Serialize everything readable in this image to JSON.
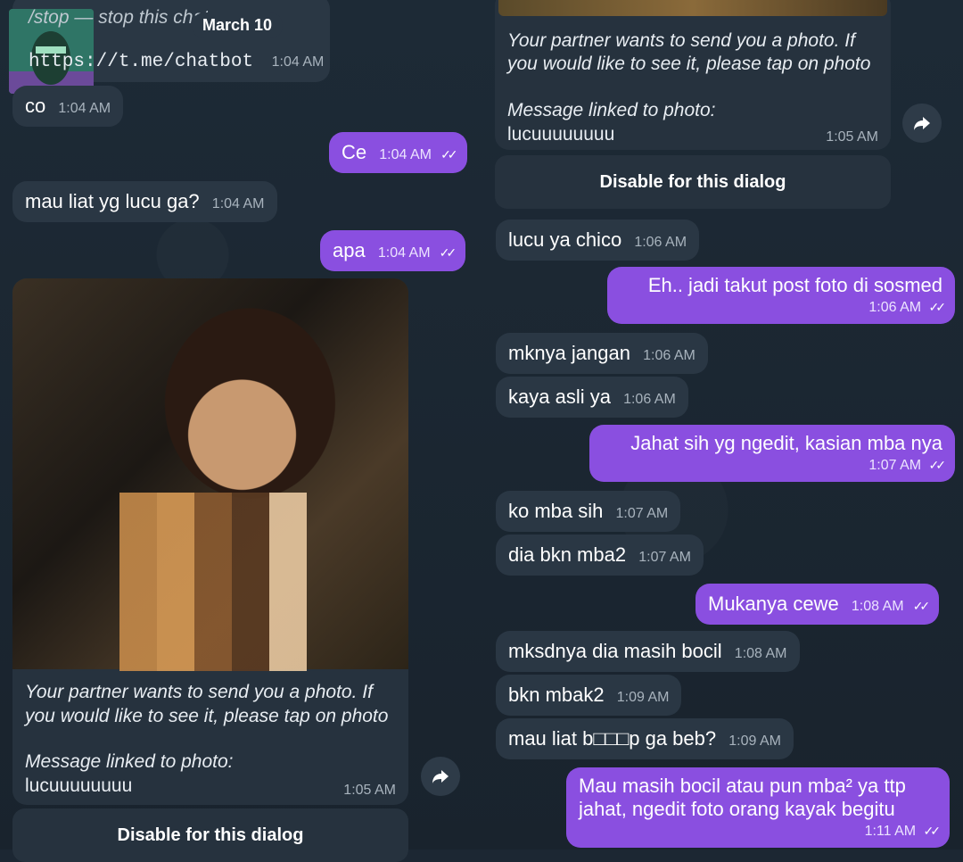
{
  "date_label": "March 10",
  "left": {
    "top_bubble": {
      "stop_text": "/stop — stop this chat",
      "link": "https://t.me/chatbot",
      "time": "1:04 AM"
    },
    "messages": [
      {
        "id": "co",
        "text": "co",
        "time": "1:04 AM",
        "dir": "in"
      },
      {
        "id": "ce",
        "text": "Ce",
        "time": "1:04 AM",
        "dir": "out"
      },
      {
        "id": "mau",
        "text": "mau liat yg lucu ga?",
        "time": "1:04 AM",
        "dir": "in"
      },
      {
        "id": "apa",
        "text": "apa",
        "time": "1:04 AM",
        "dir": "out"
      }
    ],
    "photo_card": {
      "notice_1": "Your partner wants to send you a photo. If",
      "notice_2": "you would like to see it, please tap on photo",
      "linked_label": "Message linked to photo:",
      "linked_text": "lucuuuuuuuu",
      "time": "1:05 AM"
    },
    "disable_button": "Disable for this dialog"
  },
  "right": {
    "photo_card": {
      "notice_1": "Your partner wants to send you a photo. If",
      "notice_2": "you would like to see it, please tap on photo",
      "linked_label": "Message linked to photo:",
      "linked_text": "lucuuuuuuuu",
      "time": "1:05 AM"
    },
    "disable_button": "Disable for this dialog",
    "messages": [
      {
        "text": "lucu ya chico",
        "time": "1:06 AM"
      },
      {
        "text": "Eh.. jadi takut post foto di sosmed",
        "time": "1:06 AM"
      },
      {
        "text": "mknya jangan",
        "time": "1:06 AM"
      },
      {
        "text": "kaya asli ya",
        "time": "1:06 AM"
      },
      {
        "text": "Jahat sih yg ngedit, kasian mba nya",
        "time": "1:07 AM"
      },
      {
        "text": "ko mba sih",
        "time": "1:07 AM"
      },
      {
        "text": "dia bkn mba2",
        "time": "1:07 AM"
      },
      {
        "text": "Mukanya cewe",
        "time": "1:08 AM"
      },
      {
        "text": "mksdnya dia masih bocil",
        "time": "1:08 AM"
      },
      {
        "text": "bkn mbak2",
        "time": "1:09 AM"
      },
      {
        "text": "mau liat b□□□p ga beb?",
        "time": "1:09 AM"
      },
      {
        "text_1": "Mau masih bocil atau pun mba² ya ttp",
        "text_2": "jahat, ngedit foto orang kayak begitu",
        "time": "1:11 AM"
      }
    ]
  },
  "icons": {
    "forward": "forward-arrow-icon",
    "read": "double-check-icon"
  }
}
